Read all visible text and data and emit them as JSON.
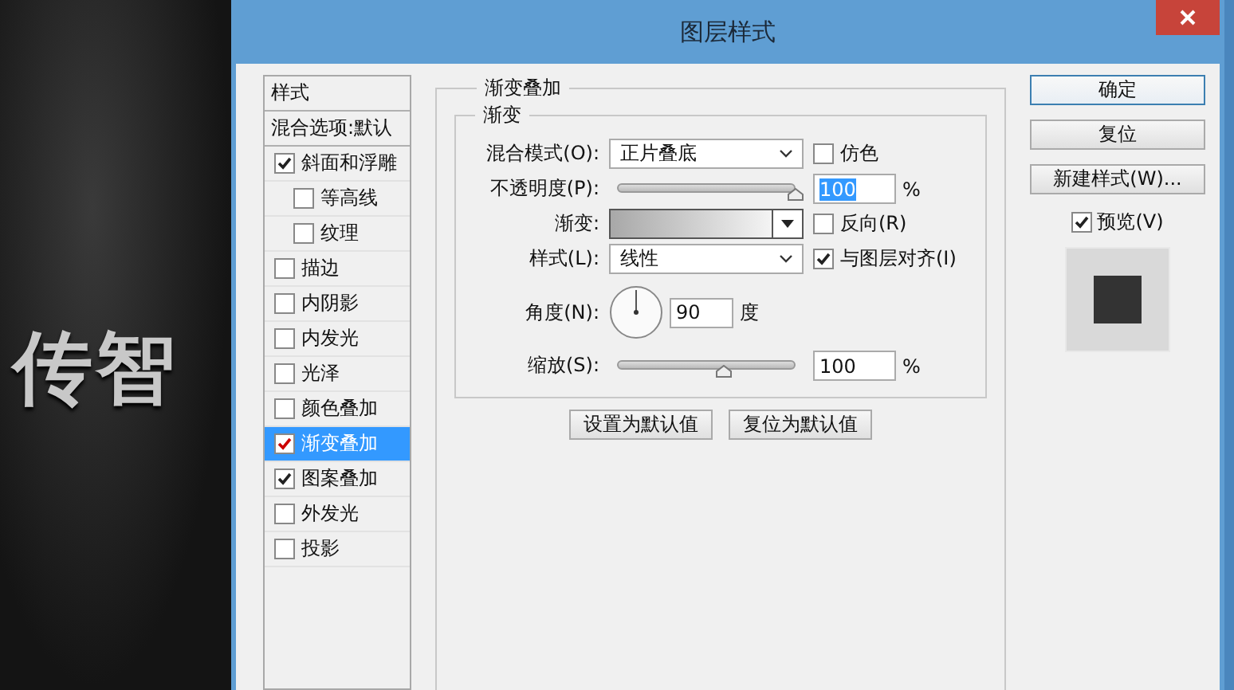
{
  "canvas": {
    "text": "传智"
  },
  "window": {
    "title": "图层样式"
  },
  "style_list": [
    {
      "kind": "header",
      "label": "样式",
      "selected": false
    },
    {
      "kind": "header",
      "label": "混合选项:默认",
      "selected": false
    },
    {
      "kind": "item",
      "label": "斜面和浮雕",
      "checked": true,
      "selected": false,
      "children": [
        {
          "label": "等高线",
          "checked": false,
          "selected": false
        },
        {
          "label": "纹理",
          "checked": false,
          "selected": false
        }
      ]
    },
    {
      "kind": "item",
      "label": "描边",
      "checked": false,
      "selected": false
    },
    {
      "kind": "item",
      "label": "内阴影",
      "checked": false,
      "selected": false
    },
    {
      "kind": "item",
      "label": "内发光",
      "checked": false,
      "selected": false
    },
    {
      "kind": "item",
      "label": "光泽",
      "checked": false,
      "selected": false
    },
    {
      "kind": "item",
      "label": "颜色叠加",
      "checked": false,
      "selected": false
    },
    {
      "kind": "item",
      "label": "渐变叠加",
      "checked": true,
      "selected": true
    },
    {
      "kind": "item",
      "label": "图案叠加",
      "checked": true,
      "selected": false
    },
    {
      "kind": "item",
      "label": "外发光",
      "checked": false,
      "selected": false
    },
    {
      "kind": "item",
      "label": "投影",
      "checked": false,
      "selected": false
    }
  ],
  "panel": {
    "title": "渐变叠加",
    "group_title": "渐变",
    "blend_mode": {
      "label": "混合模式(O):",
      "value": "正片叠底"
    },
    "dither": {
      "label": "仿色",
      "checked": false
    },
    "opacity": {
      "label": "不透明度(P):",
      "level": 1.0,
      "value": "100",
      "highlighted": true,
      "unit": "%"
    },
    "gradient": {
      "label": "渐变:"
    },
    "reverse": {
      "label": "反向(R)",
      "checked": false
    },
    "style": {
      "label": "样式(L):",
      "value": "线性"
    },
    "align": {
      "label": "与图层对齐(I)",
      "checked": true
    },
    "angle": {
      "label": "角度(N):",
      "value": "90",
      "unit": "度"
    },
    "scale": {
      "label": "缩放(S):",
      "level": 0.6,
      "value": "100",
      "unit": "%"
    },
    "buttons": [
      "设置为默认值",
      "复位为默认值"
    ]
  },
  "actions": [
    {
      "label": "确定",
      "default": true
    },
    {
      "label": "复位",
      "default": false
    },
    {
      "label": "新建样式(W)...",
      "default": false
    }
  ],
  "preview": {
    "label": "预览(V)",
    "checked": true
  }
}
